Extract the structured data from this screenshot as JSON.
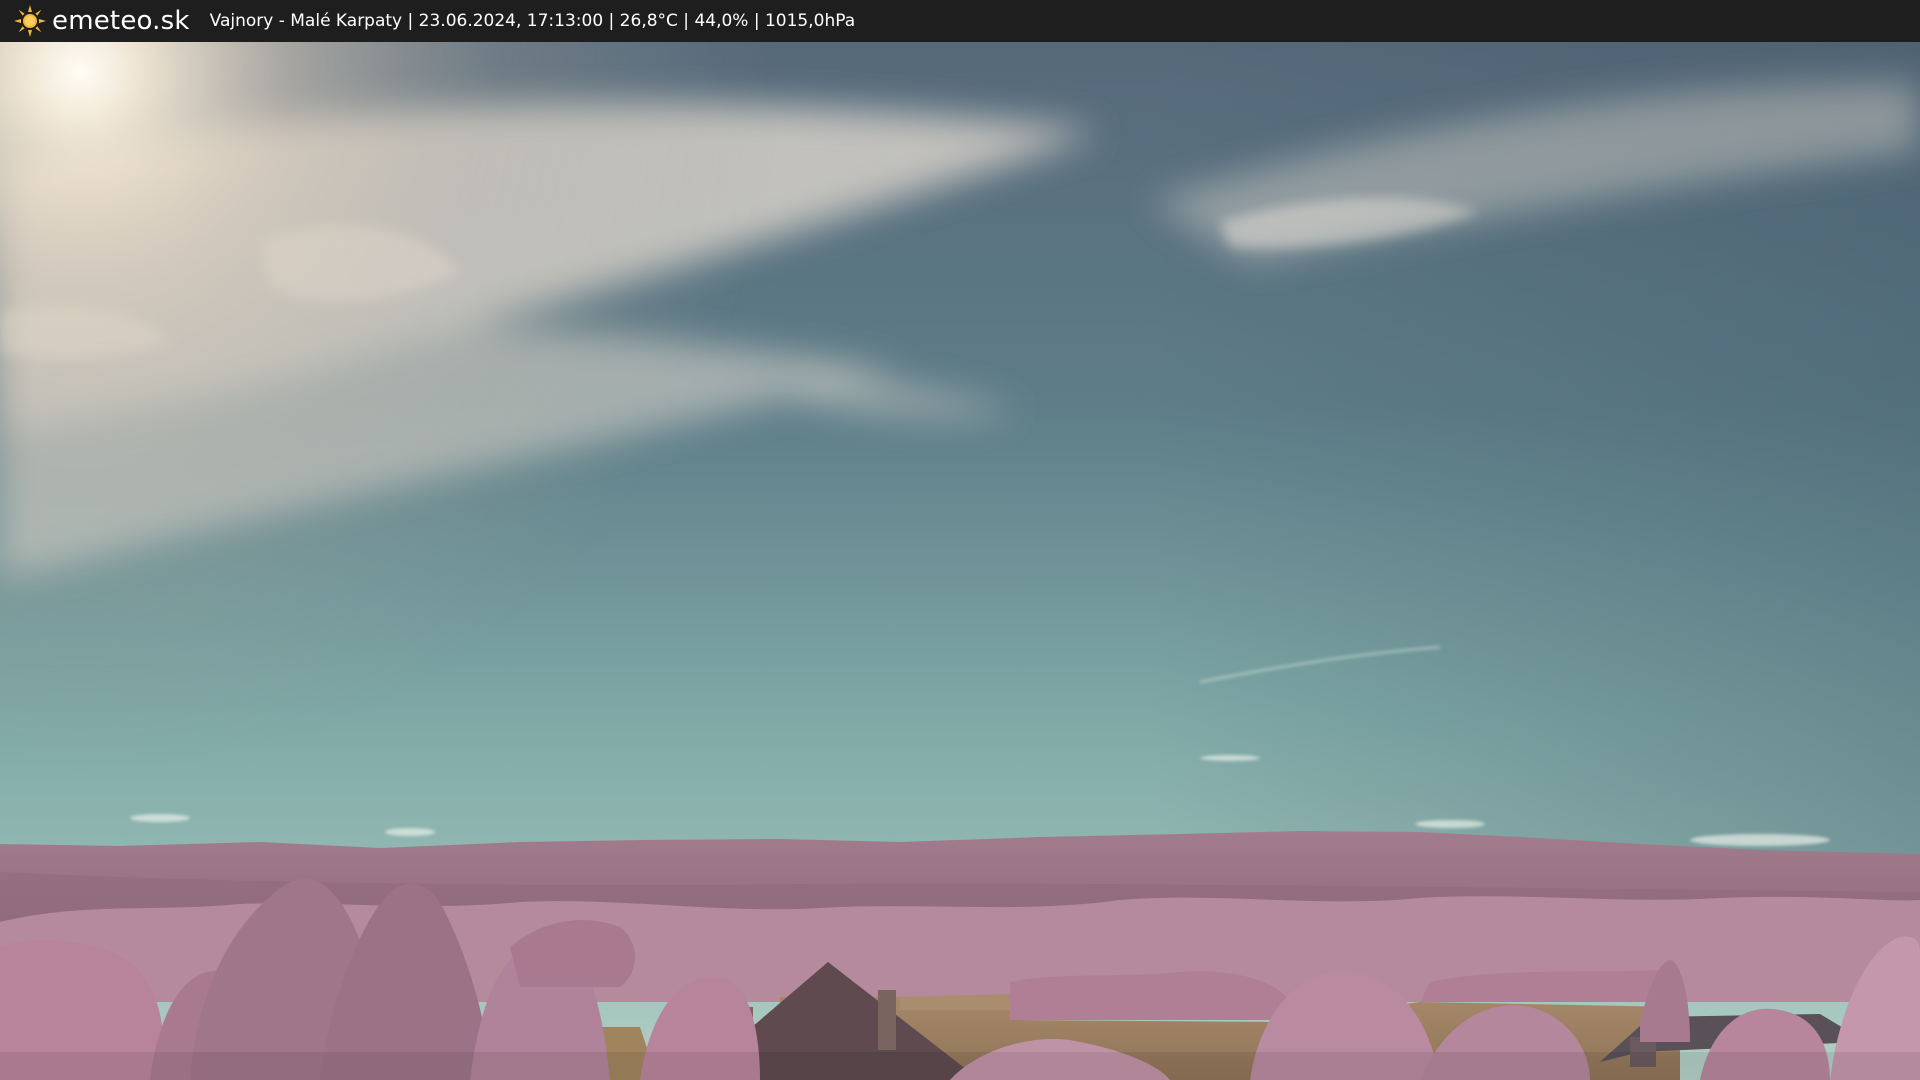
{
  "header": {
    "brand": "emeteo.sk",
    "logo_icon": "sun-icon",
    "caption": "Vajnory - Malé Karpaty | 23.06.2024, 17:13:00 | 26,8°C | 44,0% | 1015,0hPa"
  },
  "colors": {
    "topbar": "#1e1e1e",
    "sun": "#f5b73b",
    "sky_top": "#4f6677",
    "sky_horizon": "#9fc4bd",
    "foliage": "#b8849b",
    "field": "#9a7f63"
  }
}
